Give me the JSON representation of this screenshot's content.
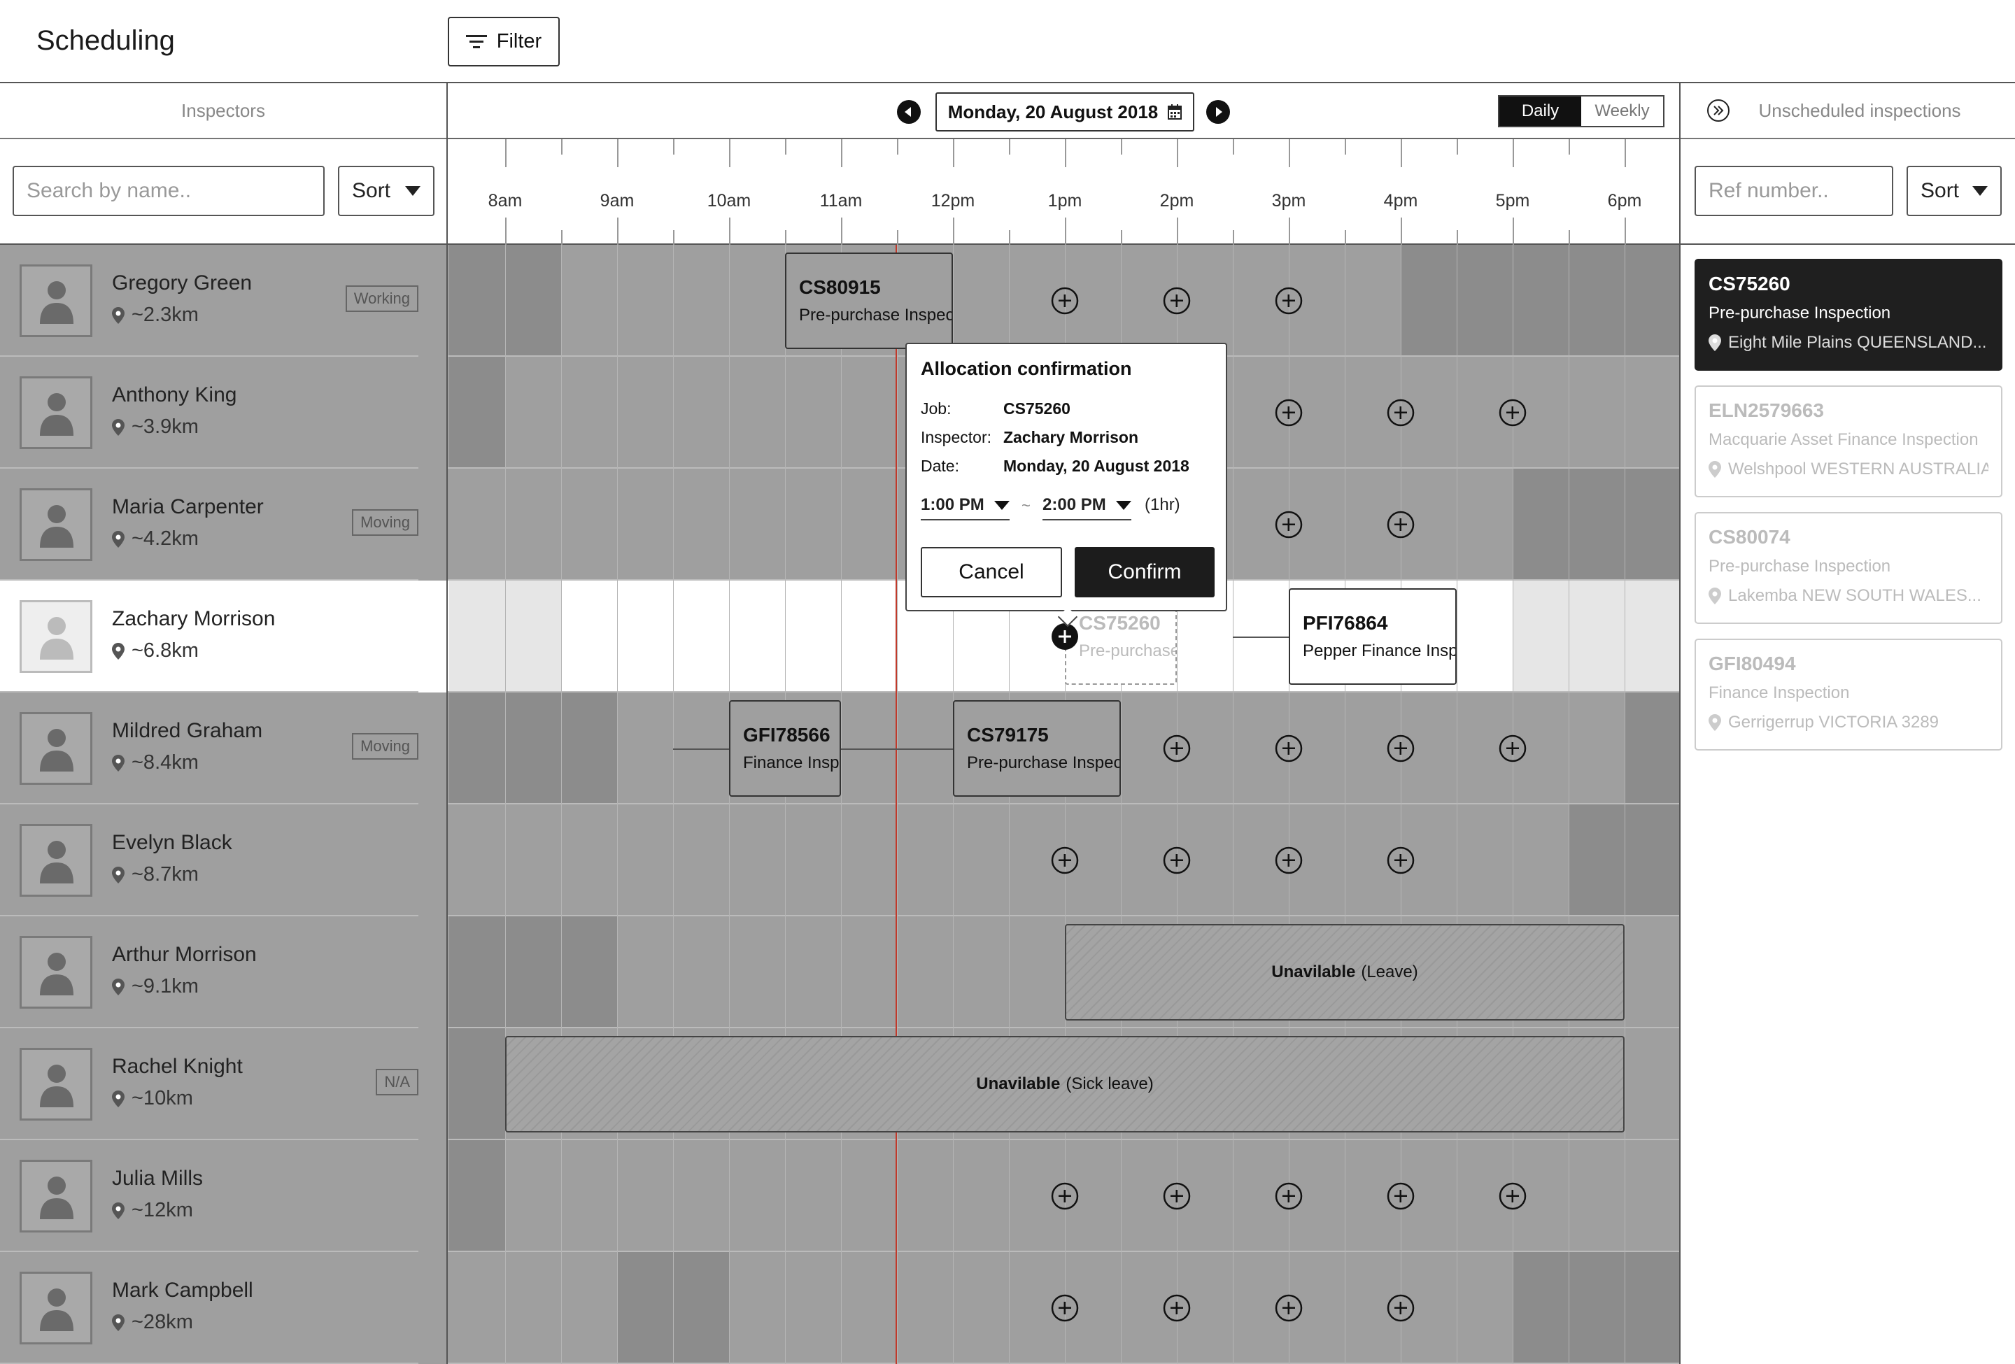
{
  "header": {
    "title": "Scheduling",
    "filter_label": "Filter"
  },
  "left": {
    "title": "Inspectors",
    "search_placeholder": "Search by name..",
    "sort_label": "Sort",
    "inspectors": [
      {
        "name": "Gregory Green",
        "distance": "~2.3km",
        "status": "Working"
      },
      {
        "name": "Anthony King",
        "distance": "~3.9km",
        "status": ""
      },
      {
        "name": "Maria Carpenter",
        "distance": "~4.2km",
        "status": "Moving"
      },
      {
        "name": "Zachary Morrison",
        "distance": "~6.8km",
        "status": ""
      },
      {
        "name": "Mildred Graham",
        "distance": "~8.4km",
        "status": "Moving"
      },
      {
        "name": "Evelyn Black",
        "distance": "~8.7km",
        "status": ""
      },
      {
        "name": "Arthur Morrison",
        "distance": "~9.1km",
        "status": ""
      },
      {
        "name": "Rachel Knight",
        "distance": "~10km",
        "status": "N/A"
      },
      {
        "name": "Julia Mills",
        "distance": "~12km",
        "status": ""
      },
      {
        "name": "Mark Campbell",
        "distance": "~28km",
        "status": ""
      }
    ]
  },
  "schedule": {
    "date": "Monday, 20 August 2018",
    "view_daily": "Daily",
    "view_weekly": "Weekly",
    "hours": [
      "8am",
      "9am",
      "10am",
      "11am",
      "12pm",
      "1pm",
      "2pm",
      "3pm",
      "4pm",
      "5pm",
      "6pm"
    ],
    "jobs": {
      "cs80915": {
        "ref": "CS80915",
        "type": "Pre-purchase Inspection"
      },
      "cs75260": {
        "ref": "CS75260",
        "type": "Pre-purchase Inspection"
      },
      "pfi76864": {
        "ref": "PFI76864",
        "type": "Pepper Finance Inspection"
      },
      "gfi78566": {
        "ref": "GFI78566",
        "type": "Finance Inspection"
      },
      "cs79175": {
        "ref": "CS79175",
        "type": "Pre-purchase Inspection"
      }
    },
    "unavailable": {
      "leave_bold": "Unavilable",
      "leave_reason": "(Leave)",
      "sick_bold": "Unavilable",
      "sick_reason": "(Sick leave)"
    }
  },
  "popup": {
    "title": "Allocation confirmation",
    "job_label": "Job:",
    "job_value": "CS75260",
    "inspector_label": "Inspector:",
    "inspector_value": "Zachary Morrison",
    "date_label": "Date:",
    "date_value": "Monday, 20 August 2018",
    "start_time": "1:00 PM",
    "separator": "~",
    "end_time": "2:00 PM",
    "duration": "(1hr)",
    "cancel_label": "Cancel",
    "confirm_label": "Confirm"
  },
  "right": {
    "title": "Unscheduled inspections",
    "search_placeholder": "Ref number..",
    "sort_label": "Sort",
    "cards": [
      {
        "ref": "CS75260",
        "type": "Pre-purchase Inspection",
        "location": "Eight Mile Plains QUEENSLAND..."
      },
      {
        "ref": "ELN2579663",
        "type": "Macquarie Asset Finance Inspection",
        "location": "Welshpool WESTERN AUSTRALIA"
      },
      {
        "ref": "CS80074",
        "type": "Pre-purchase Inspection",
        "location": "Lakemba NEW SOUTH WALES..."
      },
      {
        "ref": "GFI80494",
        "type": "Finance Inspection",
        "location": "Gerrigerrup VICTORIA 3289"
      }
    ]
  },
  "colors": {
    "accent": "#1c1c1c",
    "now_line": "#c0392b",
    "overlay": "#9f9f9f"
  }
}
